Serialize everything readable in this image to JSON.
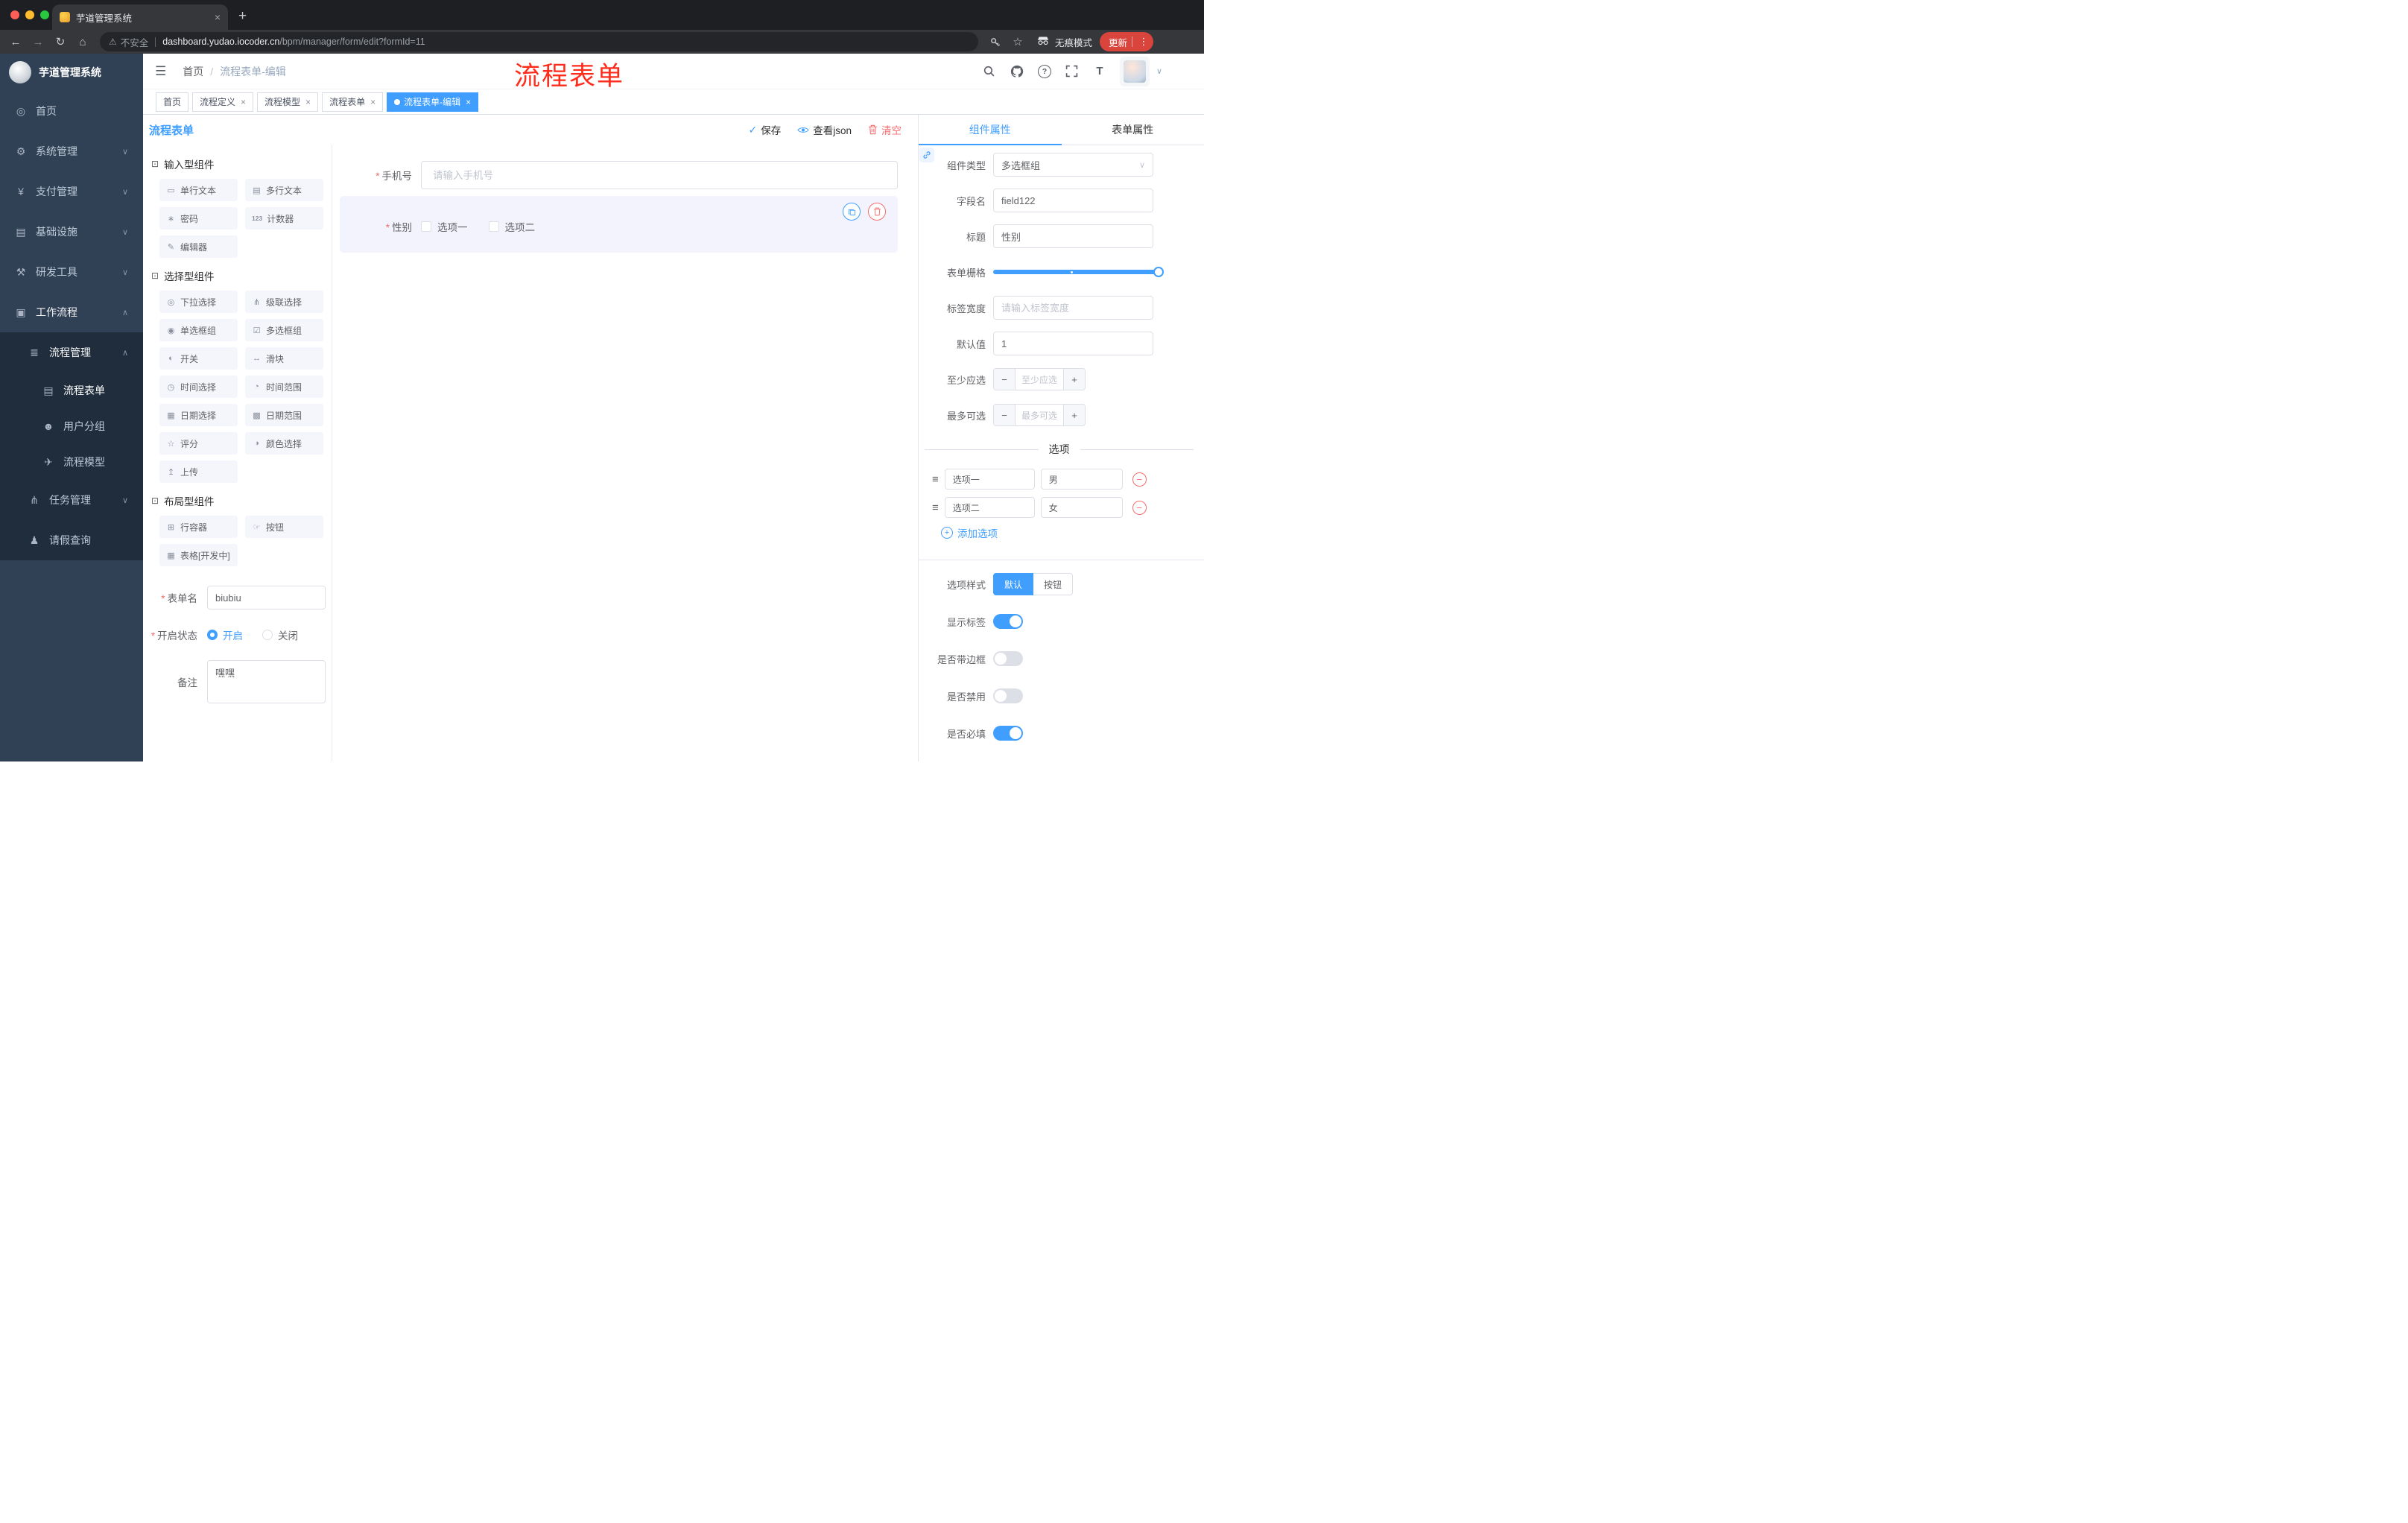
{
  "colors": {
    "primary": "#409eff",
    "danger": "#f56c6c",
    "sidebar_bg": "#304156",
    "submenu_bg": "#1f2d3d",
    "annotation_red": "#ff2b1b",
    "update_pill": "#d9453c"
  },
  "browser": {
    "tab_title": "芋道管理系统",
    "security_label": "不安全",
    "url_host": "dashboard.yudao.iocoder.cn",
    "url_path": "/bpm/manager/form/edit?formId=11",
    "incognito_label": "无痕模式",
    "update_label": "更新"
  },
  "icons": {
    "close": "×",
    "plus": "+",
    "plus_small": "+",
    "minus": "−",
    "kebab": "⋮",
    "back": "←",
    "forward": "→",
    "reload": "↻",
    "home": "⌂",
    "warning": "⚠",
    "star": "☆",
    "hamburger": "☰",
    "chevron_down": "∨",
    "chevron_up": "∧",
    "help": "?",
    "fontsize": "T",
    "check": "✓",
    "asterisk": "*",
    "drag": "≡",
    "menu_home": "◎",
    "menu_system": "⚙",
    "menu_pay": "¥",
    "menu_infra": "▤",
    "menu_dev": "⚒",
    "menu_flow": "▣",
    "menu_pm": "≣",
    "menu_form": "▤",
    "menu_group": "☻",
    "menu_model": "✈",
    "menu_task": "⋔",
    "menu_leave": "♟",
    "group_icon": "⊡",
    "chip_single": "▭",
    "chip_multi": "▤",
    "chip_password": "∗",
    "chip_counter": "123",
    "chip_editor": "✎",
    "chip_select": "◎",
    "chip_cascader": "⋔",
    "chip_radio": "◉",
    "chip_checkbox": "☑",
    "chip_switch": "◐",
    "chip_slider": "↔",
    "chip_time": "◷",
    "chip_timerange": "◔",
    "chip_date": "▦",
    "chip_daterange": "▩",
    "chip_rate": "☆",
    "chip_color": "◑",
    "chip_upload": "↥",
    "chip_row": "⊞",
    "chip_button": "☞",
    "chip_table": "▦"
  },
  "header": {
    "breadcrumb_home": "首页",
    "breadcrumb_sep": "/",
    "breadcrumb_current": "流程表单-编辑",
    "annotation": "流程表单"
  },
  "tags": {
    "items": [
      "首页",
      "流程定义",
      "流程模型",
      "流程表单",
      "流程表单-编辑"
    ]
  },
  "sidebar": {
    "logo_title": "芋道管理系统",
    "items": [
      "首页",
      "系统管理",
      "支付管理",
      "基础设施",
      "研发工具",
      "工作流程",
      "流程管理",
      "流程表单",
      "用户分组",
      "流程模型",
      "任务管理",
      "请假查询"
    ]
  },
  "designer": {
    "panel_title": "流程表单",
    "actions": {
      "save": "保存",
      "view_json": "查看json",
      "clear": "清空"
    },
    "groups": [
      {
        "title": "输入型组件",
        "items": [
          "单行文本",
          "多行文本",
          "密码",
          "计数器",
          "编辑器"
        ]
      },
      {
        "title": "选择型组件",
        "items": [
          "下拉选择",
          "级联选择",
          "单选框组",
          "多选框组",
          "开关",
          "滑块",
          "时间选择",
          "时间范围",
          "日期选择",
          "日期范围",
          "评分",
          "颜色选择",
          "上传"
        ]
      },
      {
        "title": "布局型组件",
        "items": [
          "行容器",
          "按钮",
          "表格[开发中]"
        ]
      }
    ],
    "meta": {
      "name_label": "表单名",
      "name_value": "biubiu",
      "status_label": "开启状态",
      "status_on": "开启",
      "status_off": "关闭",
      "remark_label": "备注",
      "remark_value": "嘿嘿"
    },
    "canvas": {
      "phone_label": "手机号",
      "phone_placeholder": "请输入手机号",
      "gender_label": "性别",
      "gender_opt1": "选项一",
      "gender_opt2": "选项二"
    }
  },
  "props": {
    "tab_component": "组件属性",
    "tab_form": "表单属性",
    "type_label": "组件类型",
    "type_value": "多选框组",
    "field_label": "字段名",
    "field_value": "field122",
    "title_label": "标题",
    "title_value": "性别",
    "grid_label": "表单栅格",
    "label_width_label": "标签宽度",
    "label_width_placeholder": "请输入标签宽度",
    "default_label": "默认值",
    "default_value": "1",
    "min_label": "至少应选",
    "min_placeholder": "至少应选",
    "max_label": "最多可选",
    "max_placeholder": "最多可选",
    "options_title": "选项",
    "options": [
      {
        "name": "选项一",
        "value": "男"
      },
      {
        "name": "选项二",
        "value": "女"
      }
    ],
    "add_option": "添加选项",
    "style_label": "选项样式",
    "style_default": "默认",
    "style_button": "按钮",
    "show_label": "显示标签",
    "with_border": "是否带边框",
    "disabled_label": "是否禁用",
    "required_label": "是否必填"
  }
}
